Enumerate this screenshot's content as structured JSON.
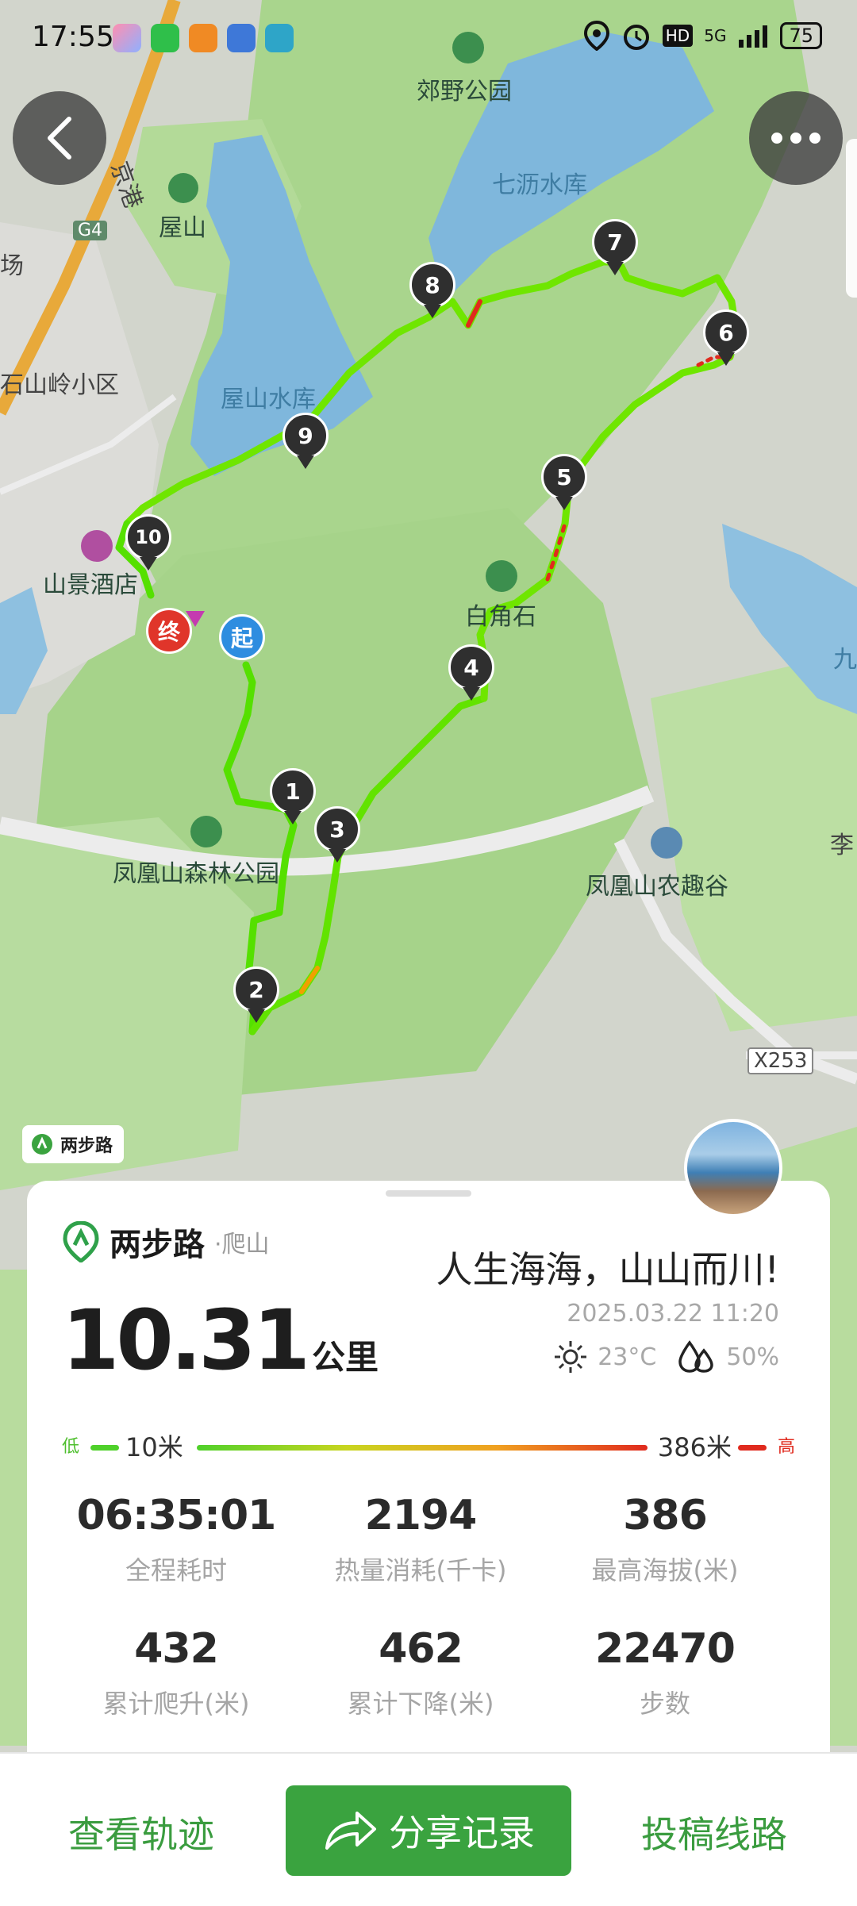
{
  "status_bar": {
    "time": "17:55",
    "network": "5G",
    "hd": "HD",
    "battery": "75"
  },
  "map_labels": {
    "park_top": "郊野公园",
    "reservoir_top": "七沥水库",
    "highway": "京港",
    "highway_code": "G4",
    "mountain_left": "屋山",
    "area_left": "场",
    "residential": "石山岭小区",
    "reservoir_left": "屋山水库",
    "hotel": "山景酒店",
    "peak": "白角石",
    "forest_park": "凤凰山森林公园",
    "farm": "凤凰山农趣谷",
    "road_code": "X253",
    "edge_right_1": "九",
    "edge_right_2": "李"
  },
  "route": {
    "start_label": "起",
    "end_label": "终",
    "markers": [
      "1",
      "2",
      "3",
      "4",
      "5",
      "6",
      "7",
      "8",
      "9",
      "10"
    ]
  },
  "watermark": {
    "text": "两步路"
  },
  "card": {
    "brand": "两步路",
    "activity": "·爬山",
    "slogan": "人生海海，山山而川!",
    "distance_value": "10.31",
    "distance_unit": "公里",
    "datetime": "2025.03.22 11:20",
    "temperature": "23°C",
    "humidity": "50%",
    "legend": {
      "low": "低",
      "high": "高",
      "min": "10米",
      "max": "386米"
    },
    "stats": [
      {
        "value": "06:35:01",
        "label": "全程耗时"
      },
      {
        "value": "2194",
        "label": "热量消耗(千卡)"
      },
      {
        "value": "386",
        "label": "最高海拔(米)"
      },
      {
        "value": "432",
        "label": "累计爬升(米)"
      },
      {
        "value": "462",
        "label": "累计下降(米)"
      },
      {
        "value": "22470",
        "label": "步数"
      }
    ]
  },
  "bottom_bar": {
    "view_track": "查看轨迹",
    "share": "分享记录",
    "submit": "投稿线路"
  },
  "colors": {
    "accent": "#3aa33f",
    "track_low": "#55e000",
    "track_high": "#e02a1e"
  }
}
